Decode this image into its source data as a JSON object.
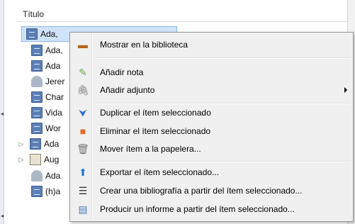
{
  "list": {
    "column_header": "Título",
    "rows": [
      {
        "text": "Ada, ",
        "icon": "document-icon",
        "selected": true
      },
      {
        "text": "Ada,",
        "icon": "document-icon"
      },
      {
        "text": "Ada",
        "icon": "document-icon"
      },
      {
        "text": "Jerer",
        "icon": "person-icon"
      },
      {
        "text": "Char",
        "icon": "document-icon"
      },
      {
        "text": "Vida",
        "icon": "document-icon"
      },
      {
        "text": "Wor",
        "icon": "document-icon"
      },
      {
        "text": "Ada",
        "icon": "document-icon",
        "expandable": true
      },
      {
        "text": "Aug",
        "icon": "newspaper-icon",
        "expandable": true
      },
      {
        "text": "Ada",
        "icon": "person-icon"
      },
      {
        "text": "(h)a",
        "icon": "document-icon"
      }
    ]
  },
  "menu": {
    "items": [
      {
        "label": "Mostrar en la biblioteca",
        "icon": "library-icon",
        "glyph": "▬",
        "color": "#b5651d"
      },
      {
        "label": "Añadir nota",
        "icon": "add-note-icon",
        "glyph": "✎",
        "color": "#6aa84f"
      },
      {
        "label": "Añadir adjunto",
        "icon": "paperclip-icon",
        "glyph": "📎",
        "color": "#7a7a7a",
        "submenu": true
      },
      {
        "label": "Duplicar el ítem seleccionado",
        "icon": "duplicate-icon",
        "glyph": "⮟",
        "color": "#2f6fd0"
      },
      {
        "label": "Eliminar el ítem seleccionado",
        "icon": "delete-icon",
        "glyph": "■",
        "color": "#e06c2c"
      },
      {
        "label": "Mover ítem a la papelera...",
        "icon": "trash-icon",
        "glyph": "🗑",
        "color": "#777777"
      },
      {
        "label": "Exportar el ítem seleccionado...",
        "icon": "export-icon",
        "glyph": "⬆",
        "color": "#1f77d0"
      },
      {
        "label": "Crear una bibliografía a partir del ítem seleccionado...",
        "icon": "bibliography-icon",
        "glyph": "☰",
        "color": "#333333"
      },
      {
        "label": "Producir un informe a partir del ítem seleccionado...",
        "icon": "report-icon",
        "glyph": "▤",
        "color": "#4a78b8"
      }
    ],
    "highlight_color": "#f6f62a"
  }
}
